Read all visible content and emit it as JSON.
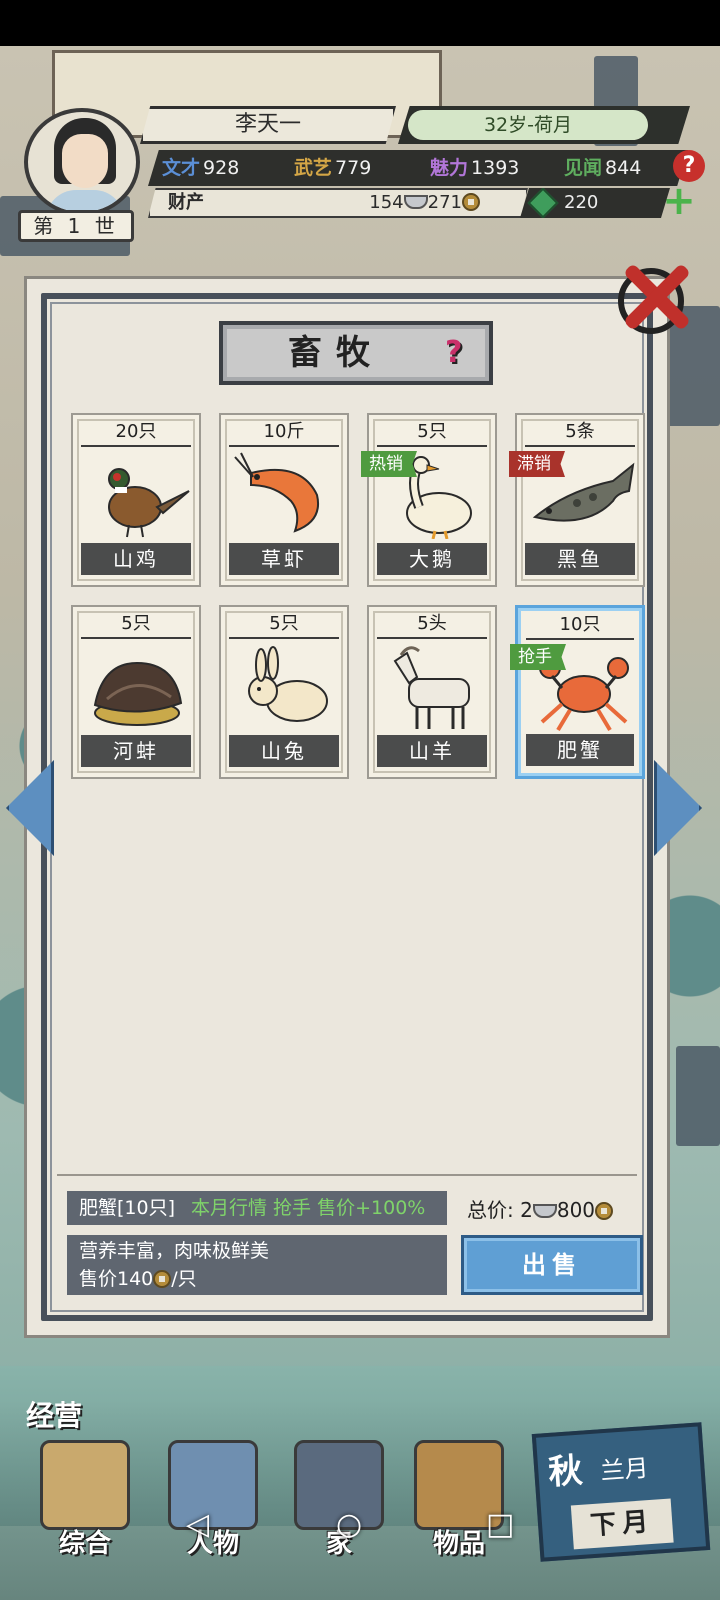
{
  "header": {
    "name": "李天一",
    "age_season": "32岁-荷月",
    "generation": "第 1 世",
    "stats": [
      {
        "label": "文才",
        "value": "928",
        "color": "#5b8fd6"
      },
      {
        "label": "武艺",
        "value": "779",
        "color": "#d4a646"
      },
      {
        "label": "魅力",
        "value": "1393",
        "color": "#b276d8"
      },
      {
        "label": "见闻",
        "value": "844",
        "color": "#5fae5f"
      }
    ],
    "wealth_label": "财产",
    "silver": "154",
    "copper": "271",
    "jade": "220"
  },
  "panel": {
    "title": "畜牧",
    "help_glyph": "?",
    "items": [
      {
        "qty": "20只",
        "name": "山鸡",
        "tag": "",
        "icon": "pheasant-icon"
      },
      {
        "qty": "10斤",
        "name": "草虾",
        "tag": "",
        "icon": "shrimp-icon"
      },
      {
        "qty": "5只",
        "name": "大鹅",
        "tag": "热销",
        "icon": "goose-icon"
      },
      {
        "qty": "5条",
        "name": "黑鱼",
        "tag": "滞销",
        "icon": "snakehead-fish-icon"
      },
      {
        "qty": "5只",
        "name": "河蚌",
        "tag": "",
        "icon": "clam-icon"
      },
      {
        "qty": "5只",
        "name": "山兔",
        "tag": "",
        "icon": "rabbit-icon"
      },
      {
        "qty": "5头",
        "name": "山羊",
        "tag": "",
        "icon": "goat-icon"
      },
      {
        "qty": "10只",
        "name": "肥蟹",
        "tag": "抢手",
        "icon": "crab-icon"
      }
    ],
    "selected": {
      "title": "肥蟹[10只]",
      "market": "本月行情 抢手 售价+100%",
      "desc": "营养丰富，肉味极鲜美",
      "price_prefix": "售价140",
      "price_unit": "/只",
      "total_label": "总价:",
      "total_silver": "2",
      "total_copper": "800",
      "sell_label": "出售"
    }
  },
  "nav": {
    "section": "经营",
    "items": [
      "综合",
      "人物",
      "家",
      "物品"
    ],
    "season": "秋",
    "month": "兰月",
    "next_month": "下月"
  },
  "colors": {
    "hot": "#4f9b3f",
    "slow": "#a9332b",
    "accent": "#5f9fd4"
  }
}
